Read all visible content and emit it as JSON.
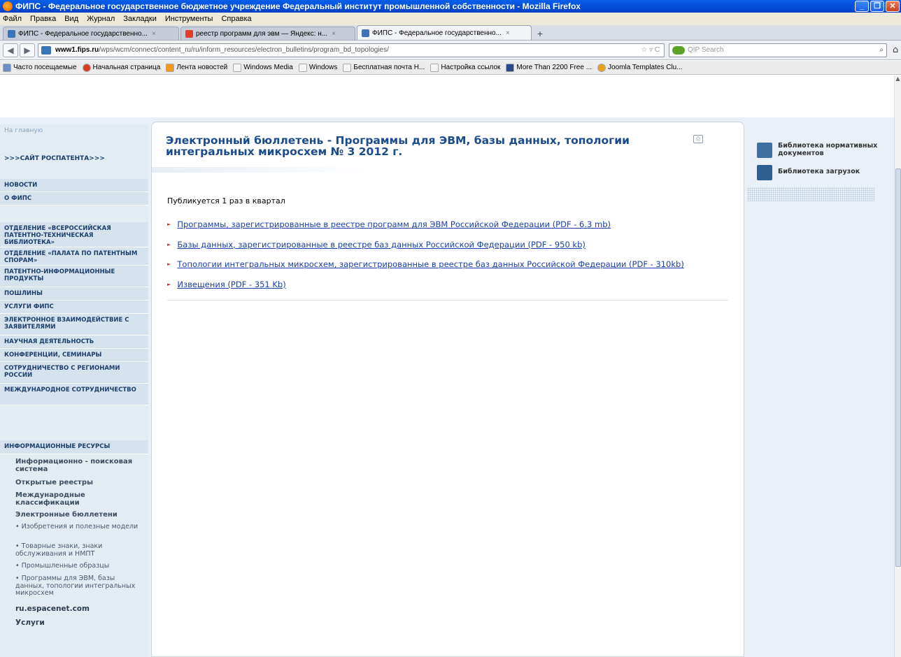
{
  "window": {
    "title": "ФИПС - Федеральное государственное бюджетное учреждение Федеральный институт промышленной собственности - Mozilla Firefox"
  },
  "menu": [
    "Файл",
    "Правка",
    "Вид",
    "Журнал",
    "Закладки",
    "Инструменты",
    "Справка"
  ],
  "tabs": [
    {
      "label": "ФИПС - Федеральное государственно...",
      "icon": "fips-icon",
      "active": false
    },
    {
      "label": "реестр программ для эвм — Яндекс: н...",
      "icon": "yandex-icon",
      "active": false
    },
    {
      "label": "ФИПС - Федеральное государственно...",
      "icon": "fips-icon",
      "active": true
    }
  ],
  "nav": {
    "url_host": "www1.fips.ru",
    "url_path": "/wps/wcm/connect/content_ru/ru/inform_resources/electron_bulletins/program_bd_topologies/",
    "search_placeholder": "QIP Search"
  },
  "bookmarks": [
    "Часто посещаемые",
    "Начальная страница",
    "Лента новостей",
    "Windows Media",
    "Windows",
    "Бесплатная почта H...",
    "Настройка ссылок",
    "More Than 2200 Free ...",
    "Joomla Templates Clu..."
  ],
  "sidebar": {
    "home": "На главную",
    "rospatent": ">>>САЙТ РОСПАТЕНТА>>>",
    "items_top": [
      "НОВОСТИ",
      "О ФИПС"
    ],
    "items_main": [
      "ОТДЕЛЕНИЕ «ВСЕРОССИЙСКАЯ ПАТЕНТНО-ТЕХНИЧЕСКАЯ БИБЛИОТЕКА»",
      "ОТДЕЛЕНИЕ «ПАЛАТА ПО ПАТЕНТНЫМ СПОРАМ»",
      "ПАТЕНТНО-ИНФОРМАЦИОННЫЕ ПРОДУКТЫ",
      "ПОШЛИНЫ",
      "УСЛУГИ ФИПС",
      "ЭЛЕКТРОННОЕ ВЗАИМОДЕЙСТВИЕ С ЗАЯВИТЕЛЯМИ",
      "НАУЧНАЯ ДЕЯТЕЛЬНОСТЬ",
      "КОНФЕРЕНЦИИ, СЕМИНАРЫ",
      "СОТРУДНИЧЕСТВО С РЕГИОНАМИ РОССИИ",
      "МЕЖДУНАРОДНОЕ СОТРУДНИЧЕСТВО"
    ],
    "info_resources": "ИНФОРМАЦИОННЫЕ РЕСУРСЫ",
    "sub_items": [
      "Информационно - поисковая система",
      "Открытые реестры",
      "Международные классификации",
      "Электронные бюллетени"
    ],
    "bulletins": [
      "• Изобретения и полезные модели",
      "• Товарные знаки, знаки обслуживания и НМПТ",
      "• Промышленные образцы",
      "• Программы для ЭВМ, базы данных, топологии интегральных микросхем"
    ],
    "bottom": [
      "ru.espacenet.com",
      "Услуги"
    ]
  },
  "content": {
    "title": "Электронный бюллетень - Программы для ЭВМ, базы данных, топологии интегральных микросхем № 3 2012 г.",
    "note": "Публикуется 1 раз в квартал",
    "links": [
      "Программы, зарегистрированные в реестре программ для ЭВМ Российской Федерации (PDF - 6.3 mb)",
      "Базы данных, зарегистрированные в реестре баз данных Российской Федерации (PDF - 950 kb)",
      "Топологии интегральных микросхем, зарегистрированные в реестре баз данных Российской Федерации (PDF - 310kb)",
      "Извещения (PDF - 351 Kb)"
    ]
  },
  "right": {
    "library_norm": "Библиотека нормативных документов",
    "library_downloads": "Библиотека загрузок"
  },
  "colors": {
    "link": "#1a3fa8",
    "title": "#1b4b8a",
    "sidebar_bg": "#e3ebf3",
    "sidebar_item_bg": "#d6e3ef",
    "bullet": "#c0392b"
  }
}
